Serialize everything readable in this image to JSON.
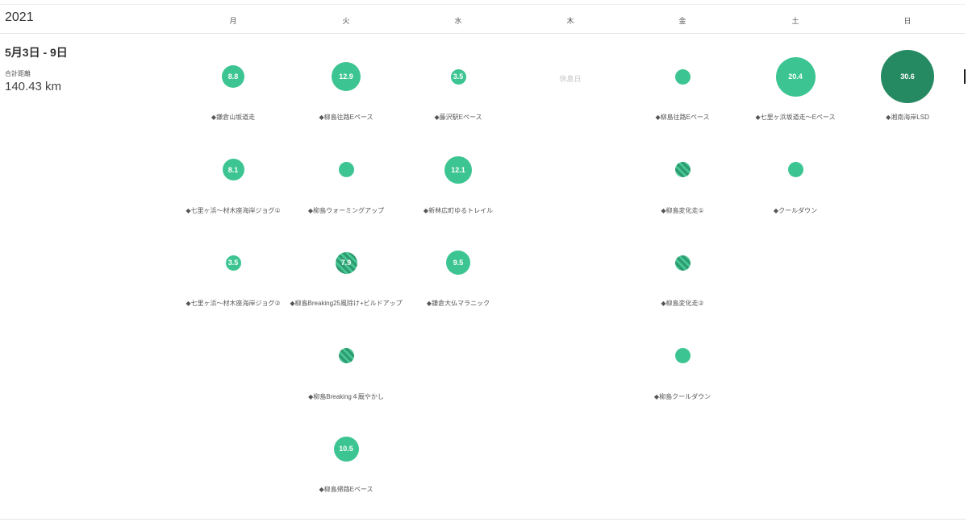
{
  "year": "2021",
  "days": [
    "月",
    "火",
    "水",
    "木",
    "金",
    "土",
    "日"
  ],
  "week": {
    "title": "5月3日 - 9日",
    "total_label": "合計距離",
    "total_value": "140.43 km"
  },
  "rest_day_label": "休息日",
  "colors": {
    "bubble": "#3cc592",
    "bubble_dark": "#258a62"
  },
  "workouts": [
    {
      "day": 0,
      "row": 0,
      "value": "8.8",
      "label": "◆鎌倉山坂道走",
      "style": "normal",
      "distance_km": 8.8
    },
    {
      "day": 0,
      "row": 1,
      "value": "8.1",
      "label": "◆七里ヶ浜～材木座海岸ジョグ①",
      "style": "normal",
      "distance_km": 8.1
    },
    {
      "day": 0,
      "row": 2,
      "value": "3.5",
      "label": "◆七里ヶ浜～材木座海岸ジョグ②",
      "style": "normal",
      "distance_km": 3.5
    },
    {
      "day": 1,
      "row": 0,
      "value": "12.9",
      "label": "◆柳島往路Eペース",
      "style": "normal",
      "distance_km": 12.9
    },
    {
      "day": 1,
      "row": 1,
      "value": "",
      "label": "◆柳島ウォーミングアップ",
      "style": "normal",
      "distance_km": 2.5
    },
    {
      "day": 1,
      "row": 2,
      "value": "7.9",
      "label": "◆柳島Breaking25風除け+ビルドアップ",
      "style": "striped",
      "distance_km": 7.9
    },
    {
      "day": 1,
      "row": 3,
      "value": "",
      "label": "◆柳島Breaking４厩やかし",
      "style": "striped",
      "distance_km": 2.5
    },
    {
      "day": 1,
      "row": 4,
      "value": "10.5",
      "label": "◆柳島帰路Eペース",
      "style": "normal",
      "distance_km": 10.5
    },
    {
      "day": 2,
      "row": 0,
      "value": "3.5",
      "label": "◆藤沢駅Eペース",
      "style": "normal",
      "distance_km": 3.5
    },
    {
      "day": 2,
      "row": 1,
      "value": "12.1",
      "label": "◆新林広町ゆるトレイル",
      "style": "normal",
      "distance_km": 12.1
    },
    {
      "day": 2,
      "row": 2,
      "value": "9.5",
      "label": "◆鎌倉大仏マラニック",
      "style": "normal",
      "distance_km": 9.5
    },
    {
      "day": 4,
      "row": 0,
      "value": "",
      "label": "◆柳島往路Eペース",
      "style": "normal",
      "distance_km": 2.5
    },
    {
      "day": 4,
      "row": 1,
      "value": "",
      "label": "◆柳島変化走①",
      "style": "striped",
      "distance_km": 2.5
    },
    {
      "day": 4,
      "row": 2,
      "value": "",
      "label": "◆柳島変化走②",
      "style": "striped",
      "distance_km": 2.5
    },
    {
      "day": 4,
      "row": 3,
      "value": "",
      "label": "◆柳島クールダウン",
      "style": "normal",
      "distance_km": 2.5
    },
    {
      "day": 5,
      "row": 0,
      "value": "20.4",
      "label": "◆七里ヶ浜坂道走～Eペース",
      "style": "normal",
      "distance_km": 20.4
    },
    {
      "day": 5,
      "row": 1,
      "value": "",
      "label": "◆クールダウン",
      "style": "normal",
      "distance_km": 2.5
    },
    {
      "day": 6,
      "row": 0,
      "value": "30.6",
      "label": "◆湘南海岸LSD",
      "style": "dark",
      "distance_km": 30.6
    }
  ]
}
